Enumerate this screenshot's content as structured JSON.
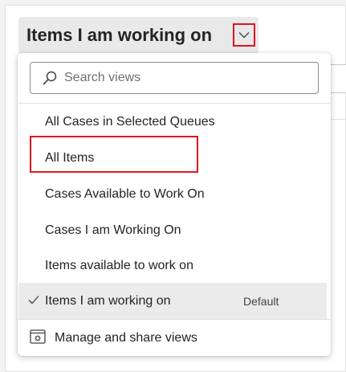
{
  "header": {
    "view_title": "Items I am working on"
  },
  "dropdown": {
    "search_placeholder": "Search views",
    "search_value": "",
    "views": [
      {
        "label": "All Cases in Selected Queues",
        "selected": false,
        "default": ""
      },
      {
        "label": "All Items",
        "selected": false,
        "default": ""
      },
      {
        "label": "Cases Available to Work On",
        "selected": false,
        "default": ""
      },
      {
        "label": "Cases I am Working On",
        "selected": false,
        "default": ""
      },
      {
        "label": "Items available to work on",
        "selected": false,
        "default": ""
      },
      {
        "label": "Items I am working on",
        "selected": true,
        "default": "Default"
      }
    ],
    "manage_label": "Manage and share views"
  },
  "icons": {
    "chevron": "chevron-down-icon",
    "search": "search-icon",
    "check": "checkmark-icon",
    "manage": "settings-view-icon"
  },
  "colors": {
    "highlight": "#e0161e",
    "selected_row": "#ebebeb",
    "header_bg": "#e9e9e9"
  }
}
